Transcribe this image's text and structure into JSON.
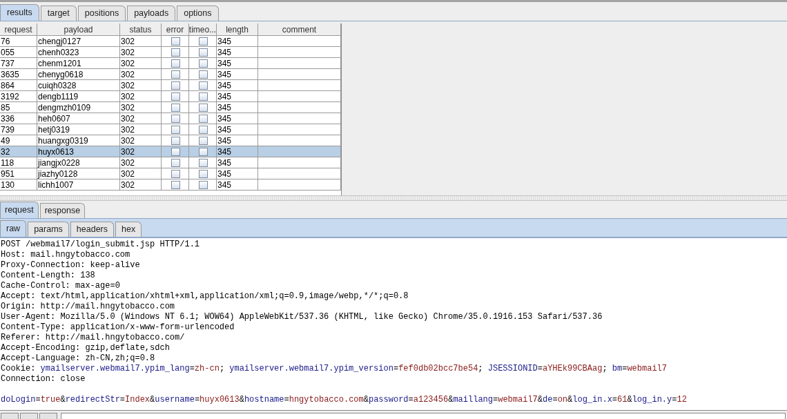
{
  "tabs": [
    {
      "label": "results",
      "selected": true
    },
    {
      "label": "target",
      "selected": false
    },
    {
      "label": "positions",
      "selected": false
    },
    {
      "label": "payloads",
      "selected": false
    },
    {
      "label": "options",
      "selected": false
    }
  ],
  "table": {
    "columns": [
      "request",
      "payload",
      "status",
      "error",
      "timeo...",
      "length",
      "comment"
    ],
    "rows": [
      {
        "request": "76",
        "payload": "chengj0127",
        "status": "302",
        "error": false,
        "timeout": false,
        "length": "345",
        "selected": false
      },
      {
        "request": "055",
        "payload": "chenh0323",
        "status": "302",
        "error": false,
        "timeout": false,
        "length": "345",
        "selected": false
      },
      {
        "request": "737",
        "payload": "chenm1201",
        "status": "302",
        "error": false,
        "timeout": false,
        "length": "345",
        "selected": false
      },
      {
        "request": "3635",
        "payload": "chenyg0618",
        "status": "302",
        "error": false,
        "timeout": false,
        "length": "345",
        "selected": false
      },
      {
        "request": "864",
        "payload": "cuiqh0328",
        "status": "302",
        "error": false,
        "timeout": false,
        "length": "345",
        "selected": false
      },
      {
        "request": "3192",
        "payload": "dengb1119",
        "status": "302",
        "error": false,
        "timeout": false,
        "length": "345",
        "selected": false
      },
      {
        "request": "85",
        "payload": "dengmzh0109",
        "status": "302",
        "error": false,
        "timeout": false,
        "length": "345",
        "selected": false
      },
      {
        "request": "336",
        "payload": "heh0607",
        "status": "302",
        "error": false,
        "timeout": false,
        "length": "345",
        "selected": false
      },
      {
        "request": "739",
        "payload": "hetj0319",
        "status": "302",
        "error": false,
        "timeout": false,
        "length": "345",
        "selected": false
      },
      {
        "request": "49",
        "payload": "huangxg0319",
        "status": "302",
        "error": false,
        "timeout": false,
        "length": "345",
        "selected": false
      },
      {
        "request": "32",
        "payload": "huyx0613",
        "status": "302",
        "error": false,
        "timeout": false,
        "length": "345",
        "selected": true
      },
      {
        "request": "118",
        "payload": "jiangjx0228",
        "status": "302",
        "error": false,
        "timeout": false,
        "length": "345",
        "selected": false
      },
      {
        "request": "951",
        "payload": "jiazhy0128",
        "status": "302",
        "error": false,
        "timeout": false,
        "length": "345",
        "selected": false
      },
      {
        "request": "130",
        "payload": "lichh1007",
        "status": "302",
        "error": false,
        "timeout": false,
        "length": "345",
        "selected": false
      }
    ]
  },
  "message_tabs": [
    {
      "label": "request",
      "selected": true
    },
    {
      "label": "response",
      "selected": false
    }
  ],
  "view_tabs": [
    {
      "label": "raw",
      "selected": true
    },
    {
      "label": "params",
      "selected": false
    },
    {
      "label": "headers",
      "selected": false
    },
    {
      "label": "hex",
      "selected": false
    }
  ],
  "raw_lines": [
    [
      {
        "kind": "plain",
        "text": "POST /webmail7/login_submit.jsp HTTP/1.1"
      }
    ],
    [
      {
        "kind": "plain",
        "text": "Host: mail.hngytobacco.com"
      }
    ],
    [
      {
        "kind": "plain",
        "text": "Proxy-Connection: keep-alive"
      }
    ],
    [
      {
        "kind": "plain",
        "text": "Content-Length: 138"
      }
    ],
    [
      {
        "kind": "plain",
        "text": "Cache-Control: max-age=0"
      }
    ],
    [
      {
        "kind": "plain",
        "text": "Accept: text/html,application/xhtml+xml,application/xml;q=0.9,image/webp,*/*;q=0.8"
      }
    ],
    [
      {
        "kind": "plain",
        "text": "Origin: http://mail.hngytobacco.com"
      }
    ],
    [
      {
        "kind": "plain",
        "text": "User-Agent: Mozilla/5.0 (Windows NT 6.1; WOW64) AppleWebKit/537.36 (KHTML, like Gecko) Chrome/35.0.1916.153 Safari/537.36"
      }
    ],
    [
      {
        "kind": "plain",
        "text": "Content-Type: application/x-www-form-urlencoded"
      }
    ],
    [
      {
        "kind": "plain",
        "text": "Referer: http://mail.hngytobacco.com/"
      }
    ],
    [
      {
        "kind": "plain",
        "text": "Accept-Encoding: gzip,deflate,sdch"
      }
    ],
    [
      {
        "kind": "plain",
        "text": "Accept-Language: zh-CN,zh;q=0.8"
      }
    ],
    [
      {
        "kind": "plain",
        "text": "Cookie: "
      },
      {
        "kind": "name",
        "text": "ymailserver.webmail7.ypim_lang"
      },
      {
        "kind": "plain",
        "text": "="
      },
      {
        "kind": "value",
        "text": "zh-cn"
      },
      {
        "kind": "plain",
        "text": "; "
      },
      {
        "kind": "name",
        "text": "ymailserver.webmail7.ypim_version"
      },
      {
        "kind": "plain",
        "text": "="
      },
      {
        "kind": "value",
        "text": "fef0db02bcc7be54"
      },
      {
        "kind": "plain",
        "text": "; "
      },
      {
        "kind": "name",
        "text": "JSESSIONID"
      },
      {
        "kind": "plain",
        "text": "="
      },
      {
        "kind": "value",
        "text": "aYHEk99CBAag"
      },
      {
        "kind": "plain",
        "text": "; "
      },
      {
        "kind": "name",
        "text": "bm"
      },
      {
        "kind": "plain",
        "text": "="
      },
      {
        "kind": "value",
        "text": "webmail7"
      }
    ],
    [
      {
        "kind": "plain",
        "text": "Connection: close"
      }
    ]
  ],
  "body": [
    {
      "kind": "name",
      "text": "doLogin"
    },
    {
      "kind": "plain",
      "text": "="
    },
    {
      "kind": "value",
      "text": "true"
    },
    {
      "kind": "plain",
      "text": "&"
    },
    {
      "kind": "name",
      "text": "redirectStr"
    },
    {
      "kind": "plain",
      "text": "="
    },
    {
      "kind": "value",
      "text": "Index"
    },
    {
      "kind": "plain",
      "text": "&"
    },
    {
      "kind": "name",
      "text": "username"
    },
    {
      "kind": "plain",
      "text": "="
    },
    {
      "kind": "value",
      "text": "huyx0613"
    },
    {
      "kind": "plain",
      "text": "&"
    },
    {
      "kind": "name",
      "text": "hostname"
    },
    {
      "kind": "plain",
      "text": "="
    },
    {
      "kind": "value",
      "text": "hngytobacco.com"
    },
    {
      "kind": "plain",
      "text": "&"
    },
    {
      "kind": "name",
      "text": "password"
    },
    {
      "kind": "plain",
      "text": "="
    },
    {
      "kind": "value",
      "text": "a123456"
    },
    {
      "kind": "plain",
      "text": "&"
    },
    {
      "kind": "name",
      "text": "maillang"
    },
    {
      "kind": "plain",
      "text": "="
    },
    {
      "kind": "value",
      "text": "webmail7"
    },
    {
      "kind": "plain",
      "text": "&"
    },
    {
      "kind": "name",
      "text": "de"
    },
    {
      "kind": "plain",
      "text": "="
    },
    {
      "kind": "value",
      "text": "on"
    },
    {
      "kind": "plain",
      "text": "&"
    },
    {
      "kind": "name",
      "text": "log_in.x"
    },
    {
      "kind": "plain",
      "text": "="
    },
    {
      "kind": "value",
      "text": "61"
    },
    {
      "kind": "plain",
      "text": "&"
    },
    {
      "kind": "name",
      "text": "log_in.y"
    },
    {
      "kind": "plain",
      "text": "="
    },
    {
      "kind": "value",
      "text": "12"
    }
  ]
}
